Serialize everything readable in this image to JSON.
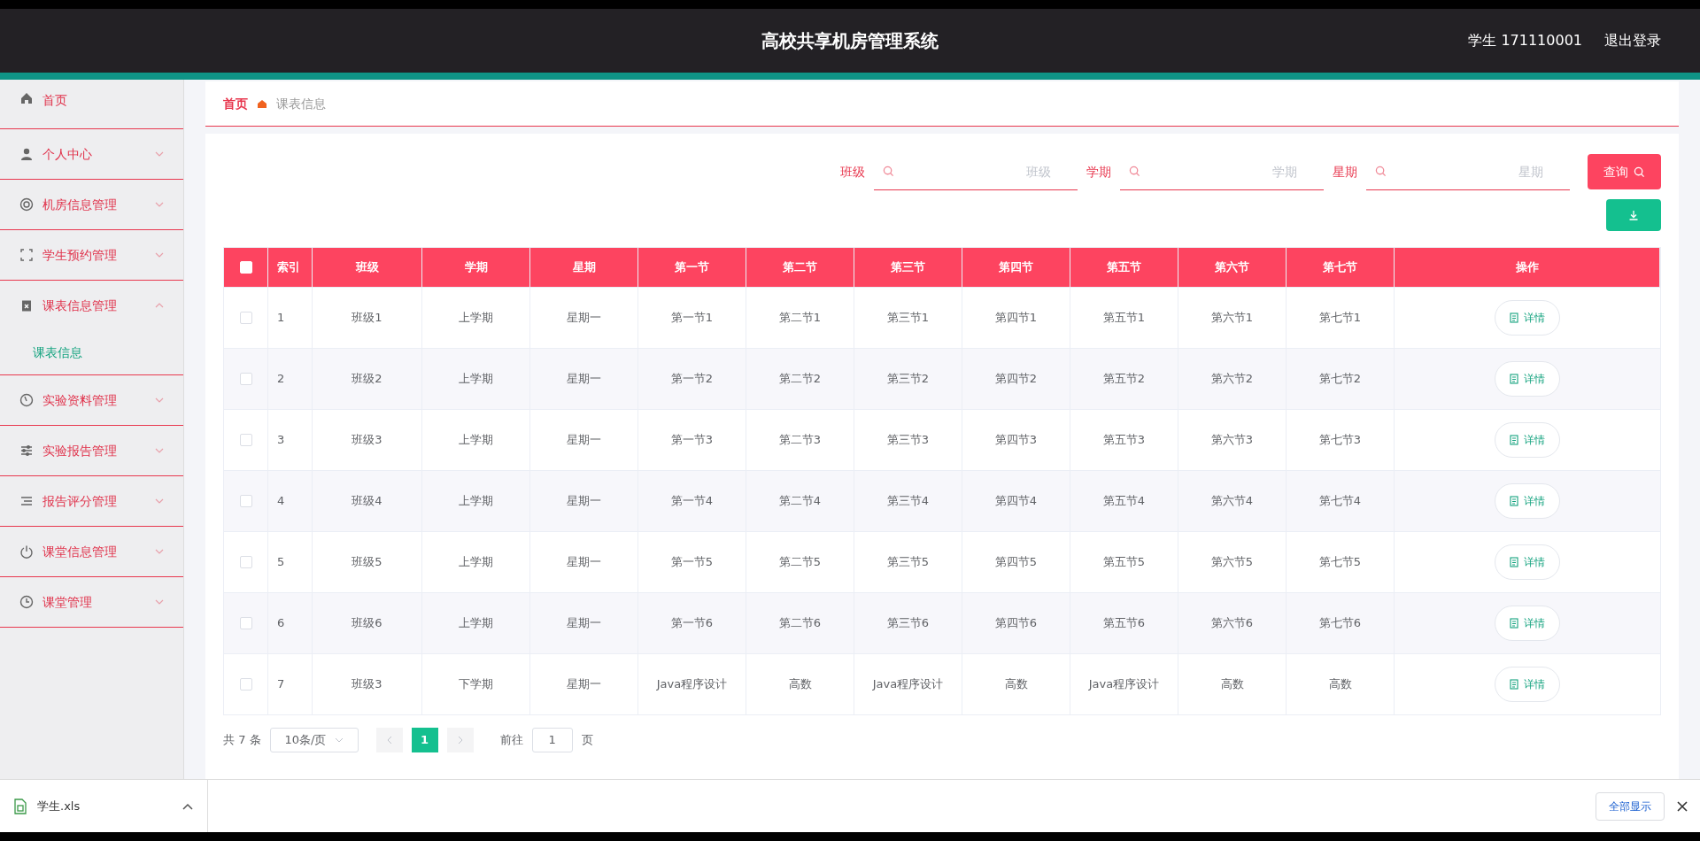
{
  "header": {
    "title": "高校共享机房管理系统",
    "user": "学生 171110001",
    "logout": "退出登录"
  },
  "sidebar": {
    "items": [
      {
        "label": "首页",
        "kind": "link"
      },
      {
        "label": "个人中心",
        "kind": "group",
        "expanded": false
      },
      {
        "label": "机房信息管理",
        "kind": "group",
        "expanded": false
      },
      {
        "label": "学生预约管理",
        "kind": "group",
        "expanded": false
      },
      {
        "label": "课表信息管理",
        "kind": "group",
        "expanded": true,
        "children": [
          {
            "label": "课表信息",
            "selected": true
          }
        ]
      },
      {
        "label": "实验资料管理",
        "kind": "group",
        "expanded": false
      },
      {
        "label": "实验报告管理",
        "kind": "group",
        "expanded": false
      },
      {
        "label": "报告评分管理",
        "kind": "group",
        "expanded": false
      },
      {
        "label": "课堂信息管理",
        "kind": "group",
        "expanded": false
      },
      {
        "label": "课堂管理",
        "kind": "group",
        "expanded": false
      }
    ]
  },
  "breadcrumb": [
    "首页",
    "课表信息"
  ],
  "search": {
    "fields": [
      {
        "label": "班级",
        "placeholder": "班级"
      },
      {
        "label": "学期",
        "placeholder": "学期"
      },
      {
        "label": "星期",
        "placeholder": "星期"
      }
    ],
    "button": "查询"
  },
  "table": {
    "header_checked": false,
    "columns": [
      "索引",
      "班级",
      "学期",
      "星期",
      "第一节",
      "第二节",
      "第三节",
      "第四节",
      "第五节",
      "第六节",
      "第七节",
      "操作"
    ],
    "rows": [
      {
        "checked": false,
        "cells": [
          "1",
          "班级1",
          "上学期",
          "星期一",
          "第一节1",
          "第二节1",
          "第三节1",
          "第四节1",
          "第五节1",
          "第六节1",
          "第七节1"
        ],
        "action": "详情"
      },
      {
        "checked": false,
        "cells": [
          "2",
          "班级2",
          "上学期",
          "星期一",
          "第一节2",
          "第二节2",
          "第三节2",
          "第四节2",
          "第五节2",
          "第六节2",
          "第七节2"
        ],
        "action": "详情"
      },
      {
        "checked": false,
        "cells": [
          "3",
          "班级3",
          "上学期",
          "星期一",
          "第一节3",
          "第二节3",
          "第三节3",
          "第四节3",
          "第五节3",
          "第六节3",
          "第七节3"
        ],
        "action": "详情"
      },
      {
        "checked": false,
        "cells": [
          "4",
          "班级4",
          "上学期",
          "星期一",
          "第一节4",
          "第二节4",
          "第三节4",
          "第四节4",
          "第五节4",
          "第六节4",
          "第七节4"
        ],
        "action": "详情"
      },
      {
        "checked": false,
        "cells": [
          "5",
          "班级5",
          "上学期",
          "星期一",
          "第一节5",
          "第二节5",
          "第三节5",
          "第四节5",
          "第五节5",
          "第六节5",
          "第七节5"
        ],
        "action": "详情"
      },
      {
        "checked": false,
        "cells": [
          "6",
          "班级6",
          "上学期",
          "星期一",
          "第一节6",
          "第二节6",
          "第三节6",
          "第四节6",
          "第五节6",
          "第六节6",
          "第七节6"
        ],
        "action": "详情"
      },
      {
        "checked": false,
        "cells": [
          "7",
          "班级3",
          "下学期",
          "星期一",
          "Java程序设计",
          "高数",
          "Java程序设计",
          "高数",
          "Java程序设计",
          "高数",
          "高数"
        ],
        "action": "详情"
      }
    ]
  },
  "pagination": {
    "total": "共 7 条",
    "page_size": "10条/页",
    "pages": [
      {
        "label": "1",
        "selected": true
      }
    ],
    "goto_label": "前往",
    "goto_value": "1",
    "goto_suffix": "页"
  },
  "download_bar": {
    "file": "学生.xls",
    "show_all": "全部显示"
  }
}
